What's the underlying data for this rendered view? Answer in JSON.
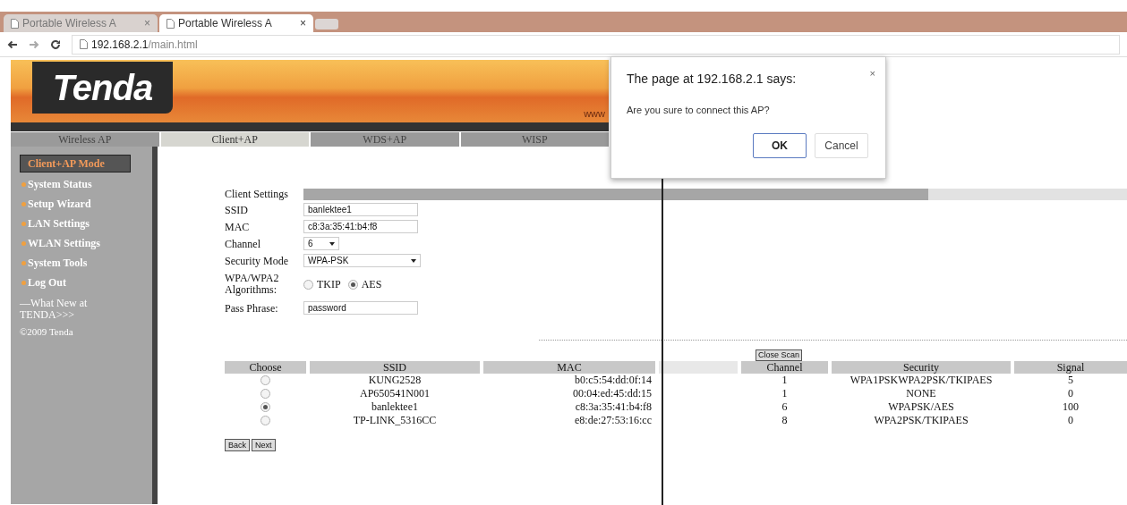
{
  "browser": {
    "tabs": [
      {
        "title": "Portable Wireless A",
        "close": "×",
        "selected": false
      },
      {
        "title": "Portable Wireless A",
        "close": "×",
        "selected": true
      }
    ],
    "url": {
      "host": "192.168.2.1",
      "path": "/main.html"
    }
  },
  "header": {
    "logo": "Tenda",
    "website_partial": "www"
  },
  "nav_tabs": [
    {
      "label": "Wireless AP",
      "selected": false
    },
    {
      "label": "Client+AP",
      "selected": true
    },
    {
      "label": "WDS+AP",
      "selected": false
    },
    {
      "label": "WISP",
      "selected": false
    }
  ],
  "sidebar": {
    "items": [
      {
        "label": "Client+AP Mode",
        "selected": true
      },
      {
        "label": "System Status",
        "selected": false
      },
      {
        "label": "Setup Wizard",
        "selected": false
      },
      {
        "label": "LAN Settings",
        "selected": false
      },
      {
        "label": "WLAN Settings",
        "selected": false
      },
      {
        "label": "System Tools",
        "selected": false
      },
      {
        "label": "Log Out",
        "selected": false
      }
    ],
    "footer_link": "—What New at TENDA>>>",
    "copyright": "©2009 Tenda"
  },
  "client_settings": {
    "title": "Client Settings",
    "fields": [
      {
        "kind": "text",
        "label": "SSID",
        "value": "banlektee1"
      },
      {
        "kind": "text",
        "label": "MAC",
        "value": "c8:3a:35:41:b4:f8"
      },
      {
        "kind": "select",
        "label": "Channel",
        "value": "6"
      },
      {
        "kind": "select",
        "label": "Security Mode",
        "value": "WPA-PSK"
      },
      {
        "kind": "radio",
        "label": "WPA/WPA2 Algorithms:",
        "options": [
          {
            "label": "TKIP",
            "selected": false
          },
          {
            "label": "AES",
            "selected": true
          }
        ]
      },
      {
        "kind": "text",
        "label": "Pass Phrase:",
        "value": "password"
      }
    ]
  },
  "scan": {
    "close_button": "Close Scan",
    "columns": [
      "Choose",
      "SSID",
      "MAC",
      "Channel",
      "Security",
      "Signal"
    ],
    "rows": [
      {
        "selected": false,
        "ssid": "KUNG2528",
        "mac": "b0:c5:54:dd:0f:14",
        "channel": "1",
        "security": "WPA1PSKWPA2PSK/TKIPAES",
        "signal": "5"
      },
      {
        "selected": false,
        "ssid": "AP650541N001",
        "mac": "00:04:ed:45:dd:15",
        "channel": "1",
        "security": "NONE",
        "signal": "0"
      },
      {
        "selected": true,
        "ssid": "banlektee1",
        "mac": "c8:3a:35:41:b4:f8",
        "channel": "6",
        "security": "WPAPSK/AES",
        "signal": "100"
      },
      {
        "selected": false,
        "ssid": "TP-LINK_5316CC",
        "mac": "e8:de:27:53:16:cc",
        "channel": "8",
        "security": "WPA2PSK/TKIPAES",
        "signal": "0"
      }
    ]
  },
  "buttons": [
    "Back",
    "Next"
  ],
  "dialog": {
    "title": "The page at 192.168.2.1 says:",
    "close": "×",
    "message": "Are you sure to connect this AP?",
    "buttons": [
      {
        "label": "OK",
        "focused": true
      },
      {
        "label": "Cancel",
        "focused": false
      }
    ]
  }
}
